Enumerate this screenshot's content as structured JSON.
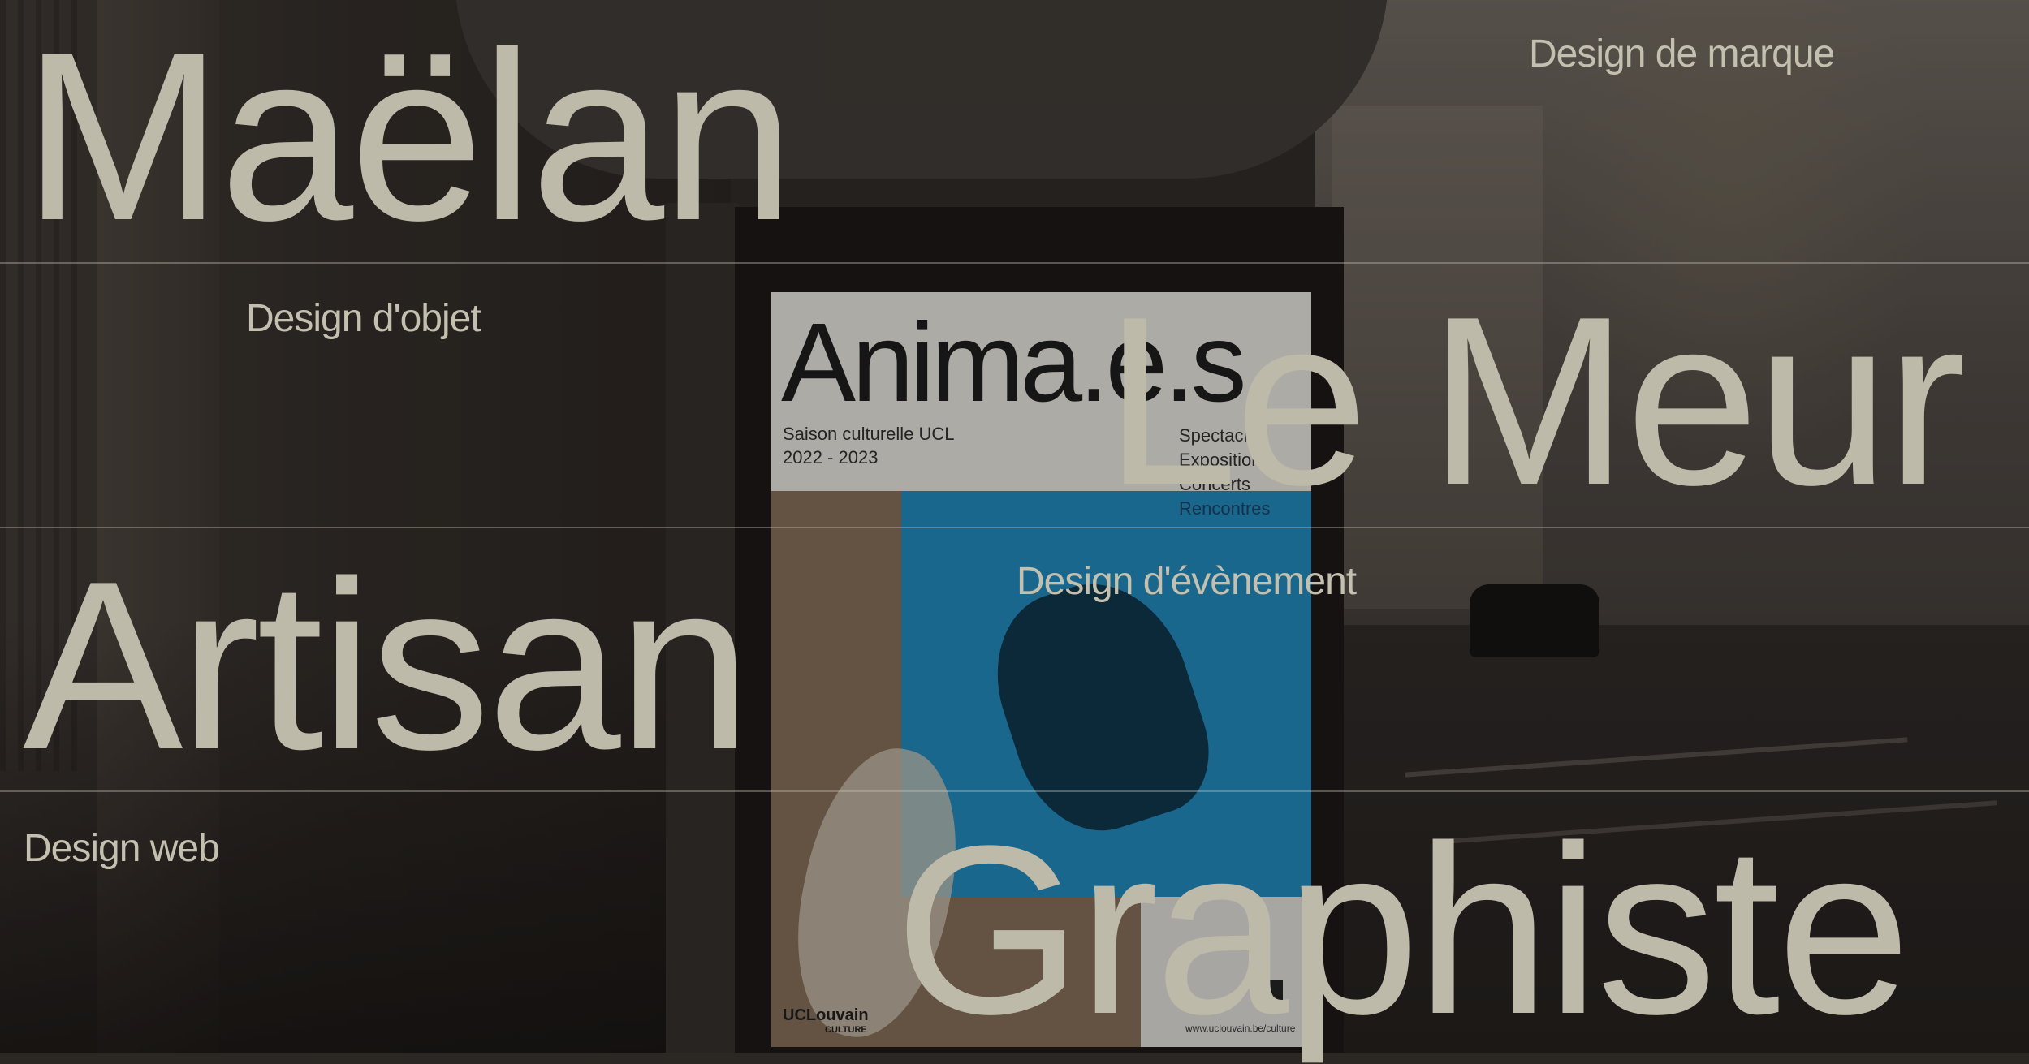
{
  "hero": {
    "first_name": "Maëlan",
    "last_name": "Le Meur",
    "role_one": "Artisan",
    "role_two": "Graphiste"
  },
  "services": {
    "brand_design": "Design de marque",
    "object_design": "Design d'objet",
    "event_design": "Design d'évènement",
    "web_design": "Design web"
  },
  "poster": {
    "title": "Anima.e.s",
    "subtitle_line1": "Saison culturelle UCL",
    "subtitle_line2": "2022 - 2023",
    "program": [
      "Spectacles",
      "Expositions",
      "Concerts",
      "Rencontres"
    ],
    "logo": "UCLouvain",
    "logo_sub": "CULTURE",
    "url": "www.uclouvain.be/culture"
  },
  "colors": {
    "text": "#bdbaa9",
    "divider": "#c8c5b9",
    "background": "#2b2723",
    "poster_blue": "#1d7fae"
  },
  "icons": {
    "qr": "qr-code-icon"
  }
}
